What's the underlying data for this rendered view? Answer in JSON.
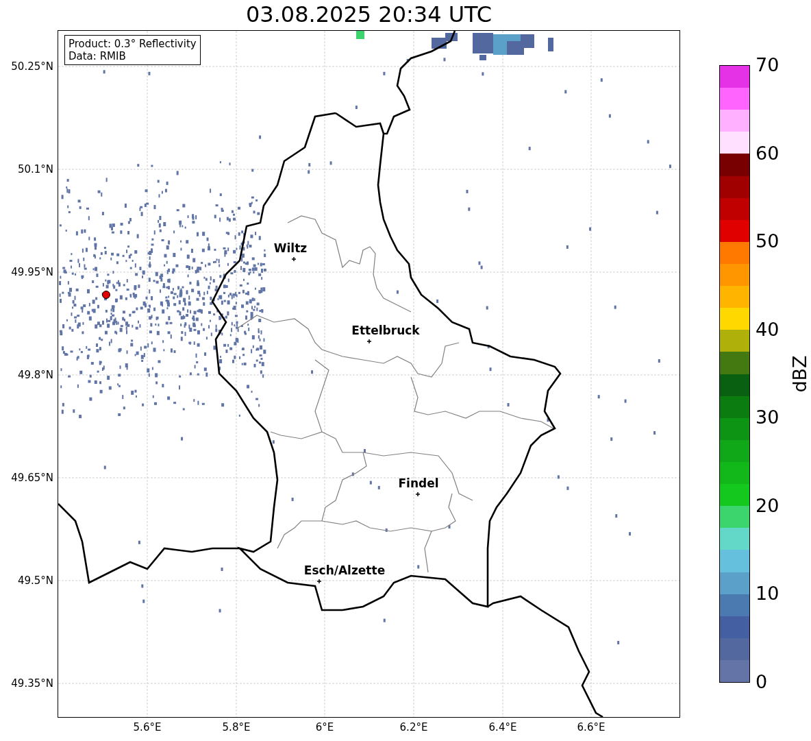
{
  "title": "03.08.2025 20:34 UTC",
  "info_box": {
    "lines": [
      "Product: 0.3° Reflectivity",
      "Data: RMIB"
    ]
  },
  "map": {
    "y_tick_labels": [
      "50.25°N",
      "50.1°N",
      "49.95°N",
      "49.8°N",
      "49.65°N",
      "49.5°N",
      "49.35°N"
    ],
    "x_tick_labels": [
      "5.6°E",
      "5.8°E",
      "6°E",
      "6.2°E",
      "6.4°E",
      "6.6°E"
    ],
    "places": [
      {
        "name": "Wiltz"
      },
      {
        "name": "Ettelbruck"
      },
      {
        "name": "Findel"
      },
      {
        "name": "Esch/Alzette"
      }
    ]
  },
  "colorbar": {
    "label": "dBZ",
    "tick_labels": [
      "70",
      "60",
      "50",
      "40",
      "30",
      "20",
      "10",
      "0"
    ],
    "bands": [
      {
        "color": "#e632e6"
      },
      {
        "color": "#ff64ff"
      },
      {
        "color": "#ffb0ff"
      },
      {
        "color": "#ffe0ff"
      },
      {
        "color": "#780000"
      },
      {
        "color": "#a00000"
      },
      {
        "color": "#c00000"
      },
      {
        "color": "#e00000"
      },
      {
        "color": "#ff7800"
      },
      {
        "color": "#ff9600"
      },
      {
        "color": "#ffb400"
      },
      {
        "color": "#ffd800"
      },
      {
        "color": "#b0b00a"
      },
      {
        "color": "#447810"
      },
      {
        "color": "#086010"
      },
      {
        "color": "#0a7c10"
      },
      {
        "color": "#0e9414"
      },
      {
        "color": "#10a818"
      },
      {
        "color": "#12b81a"
      },
      {
        "color": "#14c81e"
      },
      {
        "color": "#3cd46c"
      },
      {
        "color": "#64d8c8"
      },
      {
        "color": "#64c0dc"
      },
      {
        "color": "#5aa0c8"
      },
      {
        "color": "#4a7ab0"
      },
      {
        "color": "#4460a2"
      },
      {
        "color": "#5468a0"
      },
      {
        "color": "#6474a6"
      }
    ]
  }
}
